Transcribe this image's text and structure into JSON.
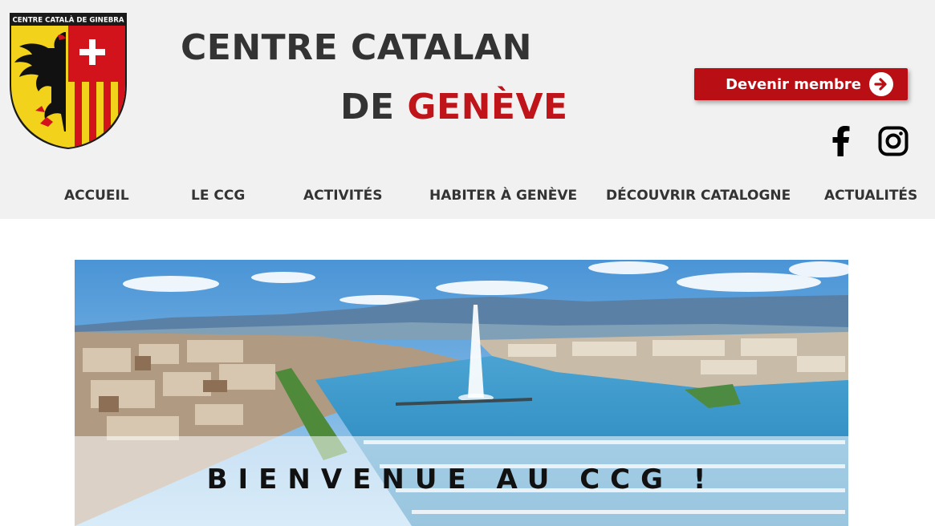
{
  "brand": {
    "logo_text": "CENTRE CATALÀ DE GINEBRA",
    "title_line1": "CENTRE CATALAN",
    "title_line2_prefix": "DE",
    "title_line2_accent": "GENÈVE",
    "accent_color": "#c0141b"
  },
  "header": {
    "member_button_label": "Devenir membre",
    "member_button_icon": "arrow-right-circle-icon",
    "social": [
      {
        "name": "facebook",
        "icon": "facebook-icon"
      },
      {
        "name": "instagram",
        "icon": "instagram-icon"
      }
    ]
  },
  "nav": {
    "items": [
      {
        "label": "ACCUEIL"
      },
      {
        "label": "LE CCG"
      },
      {
        "label": "ACTIVITÉS"
      },
      {
        "label": "HABITER À GENÈVE"
      },
      {
        "label": "DÉCOUVRIR CATALOGNE"
      },
      {
        "label": "ACTUALITÉS"
      }
    ]
  },
  "hero": {
    "title": "BIENVENUE AU CCG !"
  }
}
